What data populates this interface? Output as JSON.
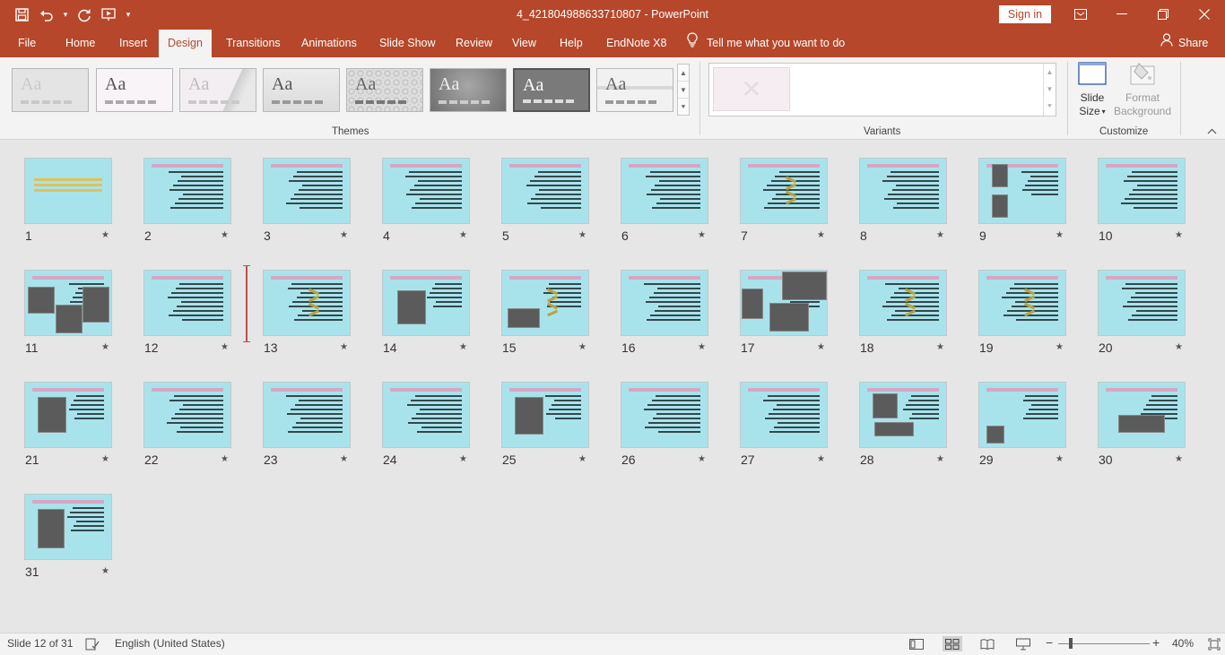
{
  "window": {
    "title": "4_421804988633710807  -  PowerPoint",
    "signin_label": "Sign in"
  },
  "tabs": [
    "File",
    "Home",
    "Insert",
    "Design",
    "Transitions",
    "Animations",
    "Slide Show",
    "Review",
    "View",
    "Help",
    "EndNote X8"
  ],
  "active_tab": "Design",
  "tellme": "Tell me what you want to do",
  "share_label": "Share",
  "ribbon": {
    "themes_label": "Themes",
    "variants_label": "Variants",
    "customize_label": "Customize",
    "theme_glyph": "Aa",
    "slide_size_line1": "Slide",
    "slide_size_line2": "Size",
    "format_bg_line1": "Format",
    "format_bg_line2": "Background"
  },
  "slides": [
    "1",
    "2",
    "3",
    "4",
    "5",
    "6",
    "7",
    "8",
    "9",
    "10",
    "11",
    "12",
    "13",
    "14",
    "15",
    "16",
    "17",
    "18",
    "19",
    "20",
    "21",
    "22",
    "23",
    "24",
    "25",
    "26",
    "27",
    "28",
    "29",
    "30",
    "31"
  ],
  "status": {
    "slide_info": "Slide 12 of 31",
    "language": "English (United States)",
    "zoom": "40%",
    "zoom_minus": "−",
    "zoom_plus": "+"
  },
  "colors": {
    "accent": "#b7472a",
    "slide_bg": "#a8e3ec"
  },
  "icons": {
    "save": "save-icon",
    "undo": "undo-icon",
    "redo": "redo-icon",
    "start": "start-from-beginning-icon",
    "star": "transition-star-icon",
    "normal": "normal-view-icon",
    "sorter": "slide-sorter-icon",
    "reading": "reading-view-icon",
    "slideshow": "slideshow-view-icon",
    "fit": "fit-slide-icon"
  }
}
